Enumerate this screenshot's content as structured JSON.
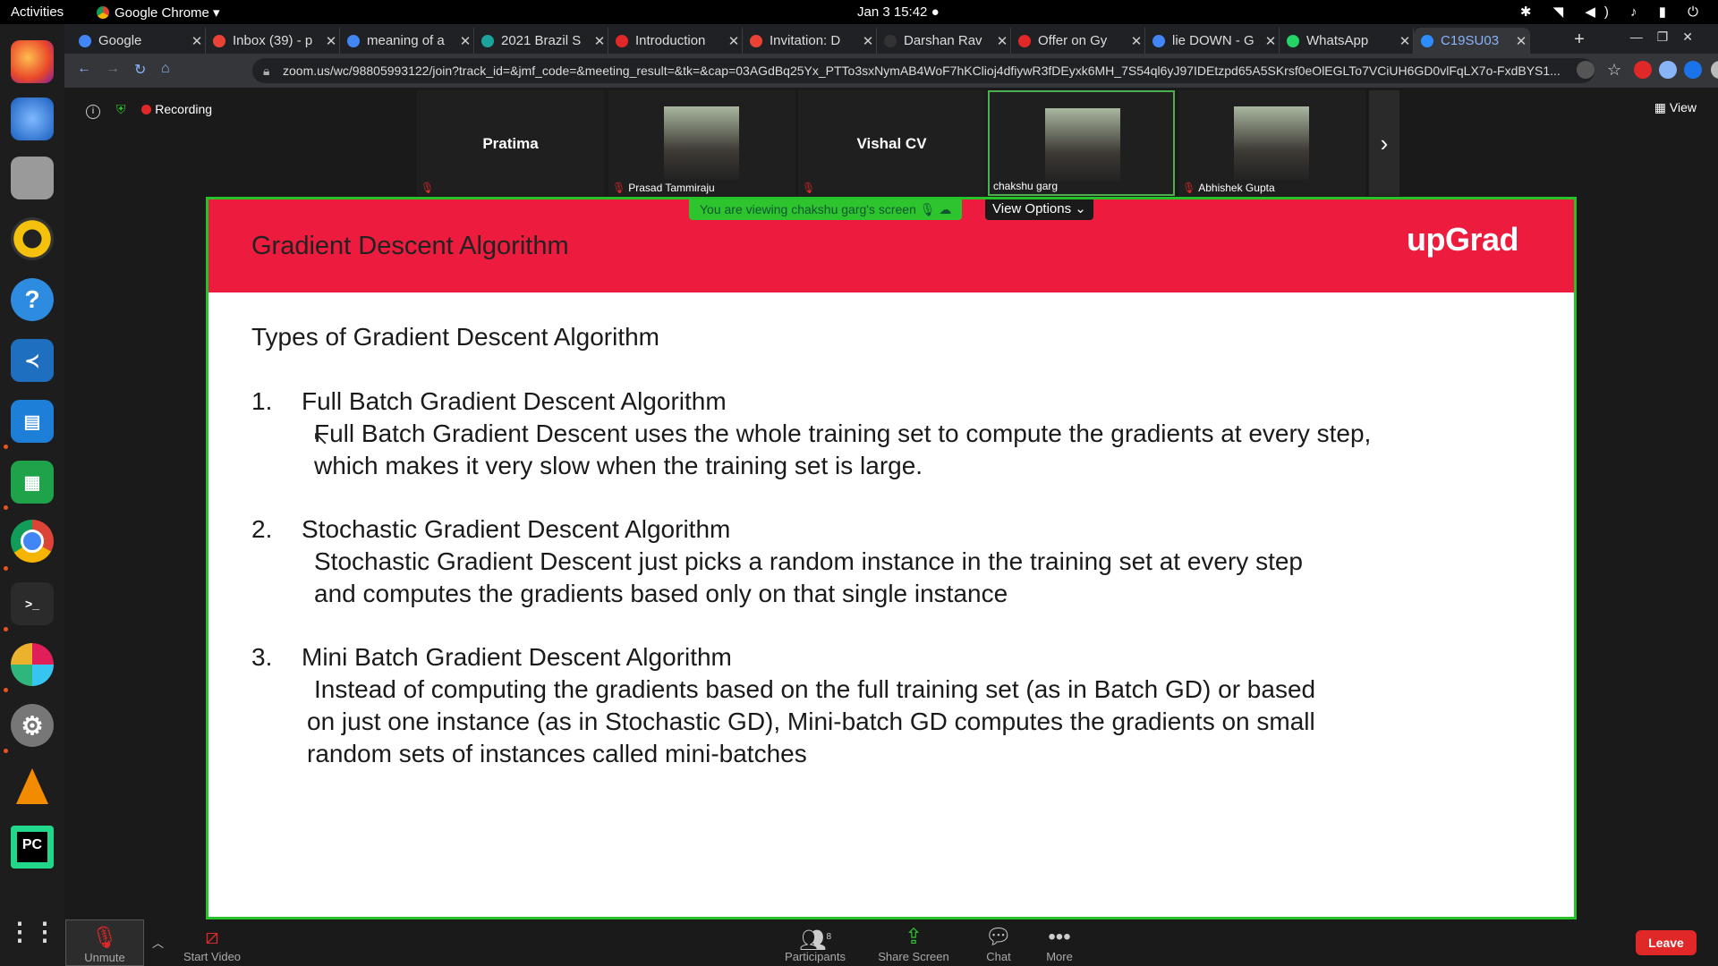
{
  "topbar": {
    "activities": "Activities",
    "app_name": "Google Chrome",
    "clock": "Jan 3  15:42"
  },
  "dock": {
    "apps": [
      "firefox-icon",
      "thunderbird-icon",
      "files-icon",
      "rhythmbox-icon",
      "help-icon",
      "vscode-icon",
      "libreoffice-impress-icon",
      "libreoffice-calc-icon",
      "chrome-icon",
      "terminal-icon",
      "slack-icon",
      "settings-icon",
      "vlc-icon",
      "pycharm-icon"
    ],
    "apps_grid": "show-applications-icon"
  },
  "browser": {
    "tabs": [
      {
        "title": "Google",
        "color": "#4285f4"
      },
      {
        "title": "Inbox (39) - p",
        "color": "#ea4335"
      },
      {
        "title": "meaning of a",
        "color": "#4285f4"
      },
      {
        "title": "2021 Brazil S",
        "color": "#1ba39c"
      },
      {
        "title": "Introduction",
        "color": "#e02828"
      },
      {
        "title": "Invitation: D",
        "color": "#ea4335"
      },
      {
        "title": "Darshan Rav",
        "color": "#333333"
      },
      {
        "title": "Offer on Gy",
        "color": "#e02828"
      },
      {
        "title": "lie DOWN - G",
        "color": "#4285f4"
      },
      {
        "title": "WhatsApp",
        "color": "#25d366"
      },
      {
        "title": "C19SU03",
        "color": "#2d8cff"
      }
    ],
    "url": "zoom.us/wc/98805993122/join?track_id=&jmf_code=&meeting_result=&tk=&cap=03AGdBq25Yx_PTTo3sxNymAB4WoF7hKClioj4dfiywR3fDEyxk6MH_7S54ql6yJ97IDEtzpd65A5SKrsf0eOlEGLTo7VCiUH6GD0vlFqLX7o-FxdBYS1..."
  },
  "meeting": {
    "recording_label": "Recording",
    "view_label": "View",
    "participants": [
      {
        "name": "Pratima",
        "label": "",
        "has_photo": false
      },
      {
        "name": "",
        "label": "Prasad Tammiraju",
        "has_photo": true
      },
      {
        "name": "Vishal CV",
        "label": "",
        "has_photo": false
      },
      {
        "name": "",
        "label": "chakshu garg",
        "has_photo": true
      },
      {
        "name": "",
        "label": "Abhishek Gupta",
        "has_photo": true
      }
    ],
    "viewing_banner": "You are viewing chakshu garg's screen",
    "view_options": "View Options"
  },
  "slide": {
    "title": "Gradient Descent Algorithm",
    "logo": "upGrad",
    "heading": "Types of Gradient Descent Algorithm",
    "items": [
      {
        "num": "1.",
        "title": "Full Batch Gradient Descent Algorithm",
        "lines": [
          "Full Batch Gradient Descent uses the whole training set to compute the gradients at every step,",
          "which  makes it very slow when the training set is large."
        ]
      },
      {
        "num": "2.",
        "title": "Stochastic Gradient Descent Algorithm",
        "lines": [
          "Stochastic Gradient Descent just picks a random instance in the training set at every step",
          "and computes the gradients based only on that single instance"
        ]
      },
      {
        "num": "3.",
        "title": "Mini Batch Gradient Descent Algorithm",
        "lines": [
          "Instead of computing the gradients based on the full training set (as in Batch GD) or based",
          "on just one instance (as in Stochastic GD), Mini-batch GD computes the gradients on small",
          "random sets of instances called mini-batches"
        ]
      }
    ]
  },
  "toolbar": {
    "unmute": "Unmute",
    "start_video": "Start Video",
    "participants": "Participants",
    "participants_count": "8",
    "share_screen": "Share Screen",
    "chat": "Chat",
    "more": "More",
    "leave": "Leave"
  }
}
